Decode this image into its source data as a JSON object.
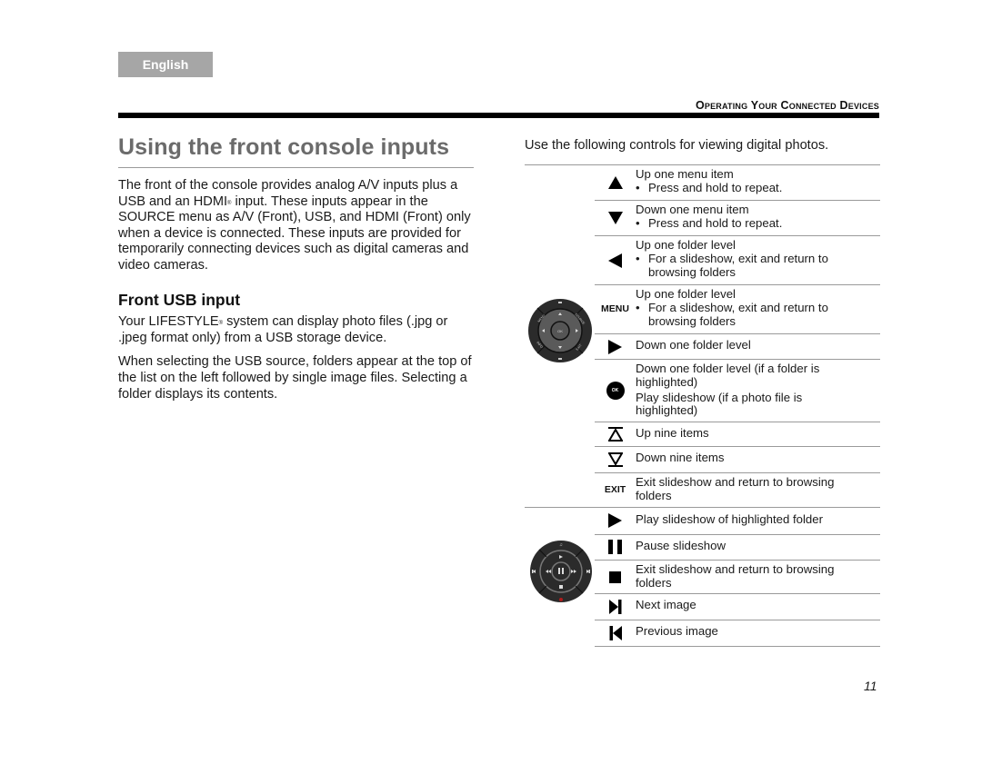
{
  "language_tab": "English",
  "section_header": "Operating Your Connected Devices",
  "page_title": "Using the front console inputs",
  "intro_paragraph": {
    "before_sup": "The front of the console provides analog A/V inputs plus a USB and an HDMI",
    "sup": "®",
    "after_sup": " input. These inputs appear in the SOURCE menu as A/V (Front), USB, and HDMI (Front) only when a device is connected. These inputs are provided for temporarily connecting devices such as digital cameras and video cameras."
  },
  "usb_section": {
    "heading": "Front USB input",
    "paragraph1": {
      "before_sup": "Your LIFESTYLE",
      "sup": "®",
      "after_sup": " system can display photo files (.jpg or .jpeg format only) from a USB storage device."
    },
    "paragraph2": "When selecting the USB source, folders appear at the top of the list on the left followed by single image files. Selecting a folder displays its contents."
  },
  "controls_intro": "Use the following controls for viewing digital photos.",
  "navigation_controls": [
    {
      "icon": "up-arrow-icon",
      "label": "Up one menu item",
      "bullet": "Press and hold to repeat."
    },
    {
      "icon": "down-arrow-icon",
      "label": "Down one menu item",
      "bullet": "Press and hold to repeat."
    },
    {
      "icon": "left-arrow-icon",
      "label": "Up one folder level",
      "bullet": "For a slideshow, exit and return to browsing folders"
    },
    {
      "icon": "menu-button",
      "icon_text": "MENU",
      "label": "Up one folder level",
      "bullet": "For a slideshow, exit and return to browsing folders"
    },
    {
      "icon": "right-arrow-icon",
      "label": "Down one folder level"
    },
    {
      "icon": "ok-button",
      "icon_text": "OK",
      "label": "Down one folder level (if a folder is highlighted)",
      "label2": "Play slideshow (if a photo file is highlighted)"
    },
    {
      "icon": "page-up-icon",
      "label": "Up nine items"
    },
    {
      "icon": "page-down-icon",
      "label": "Down nine items"
    },
    {
      "icon": "exit-button",
      "icon_text": "EXIT",
      "label": "Exit slideshow and return to browsing folders"
    }
  ],
  "playback_controls": [
    {
      "icon": "play-icon",
      "label": "Play slideshow of highlighted folder"
    },
    {
      "icon": "pause-icon",
      "label": "Pause slideshow"
    },
    {
      "icon": "stop-icon",
      "label": "Exit slideshow and return to browsing folders"
    },
    {
      "icon": "next-icon",
      "label": "Next image"
    },
    {
      "icon": "previous-icon",
      "label": "Previous image"
    }
  ],
  "remote_nav_labels": {
    "ok": "OK",
    "menu": "MENU",
    "source": "SOURCE",
    "exit": "EXIT",
    "info": "INFO"
  },
  "page_number": "11"
}
